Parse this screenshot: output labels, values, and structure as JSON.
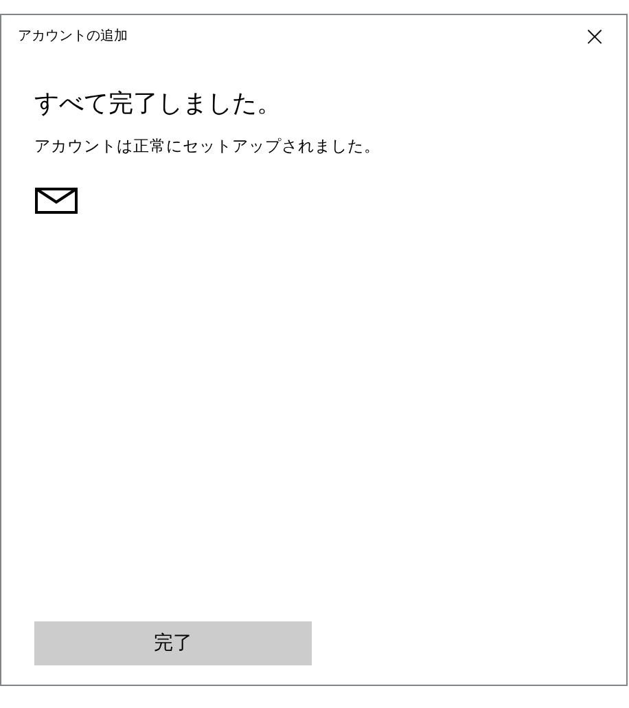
{
  "window": {
    "title": "アカウントの追加",
    "close": "×"
  },
  "heading": "すべて完了しました。",
  "message": "アカウントは正常にセットアップされました。",
  "buttons": [
    "完了"
  ]
}
